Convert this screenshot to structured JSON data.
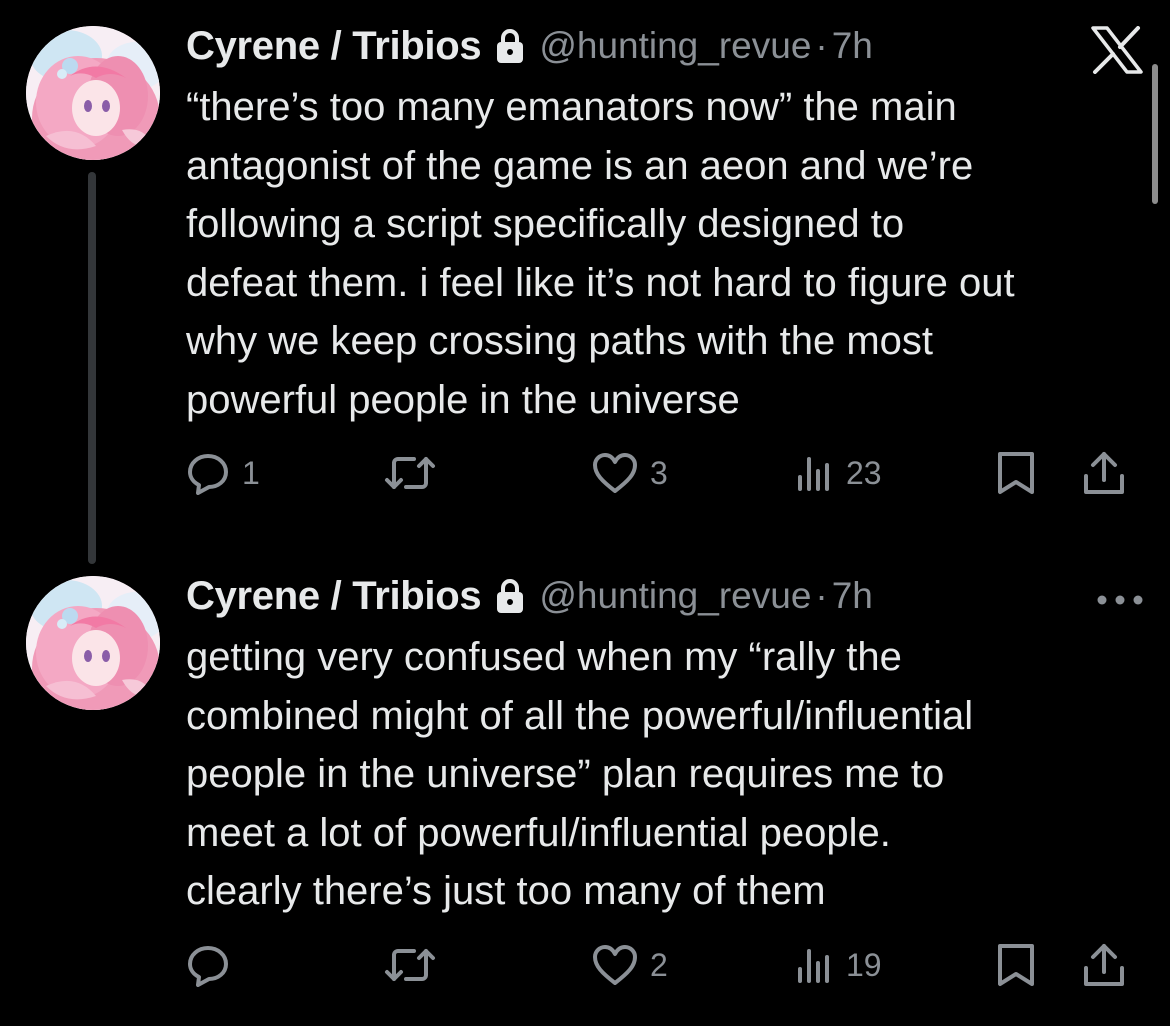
{
  "colors": {
    "background": "#000000",
    "primary_text": "#e7e9ea",
    "secondary_text": "#8b9096",
    "thread_line": "#333639"
  },
  "tweets": [
    {
      "display_name": "Cyrene / Tribios",
      "protected_icon": "lock-icon",
      "handle": "@hunting_revue",
      "separator": "·",
      "time": "7h",
      "top_right_icon": "x-logo-icon",
      "text_lines": [
        "“there’s too many emanators now” the main",
        "antagonist of the game is an aeon and we’re",
        "following a script specifically designed to",
        "defeat them. i feel like it’s not hard to figure out",
        "why we keep crossing paths with the most",
        "powerful people in the universe"
      ],
      "actions": {
        "replies": "1",
        "reposts": "",
        "likes": "3",
        "views": "23"
      }
    },
    {
      "display_name": "Cyrene / Tribios",
      "protected_icon": "lock-icon",
      "handle": "@hunting_revue",
      "separator": "·",
      "time": "7h",
      "top_right_icon": "more-icon",
      "text_lines": [
        "getting very confused when my “rally the",
        "combined might of all the powerful/influential",
        "people in the universe” plan requires me to",
        "meet a lot of powerful/influential people.",
        "clearly there’s just too many of them"
      ],
      "actions": {
        "replies": "",
        "reposts": "",
        "likes": "2",
        "views": "19"
      }
    }
  ]
}
